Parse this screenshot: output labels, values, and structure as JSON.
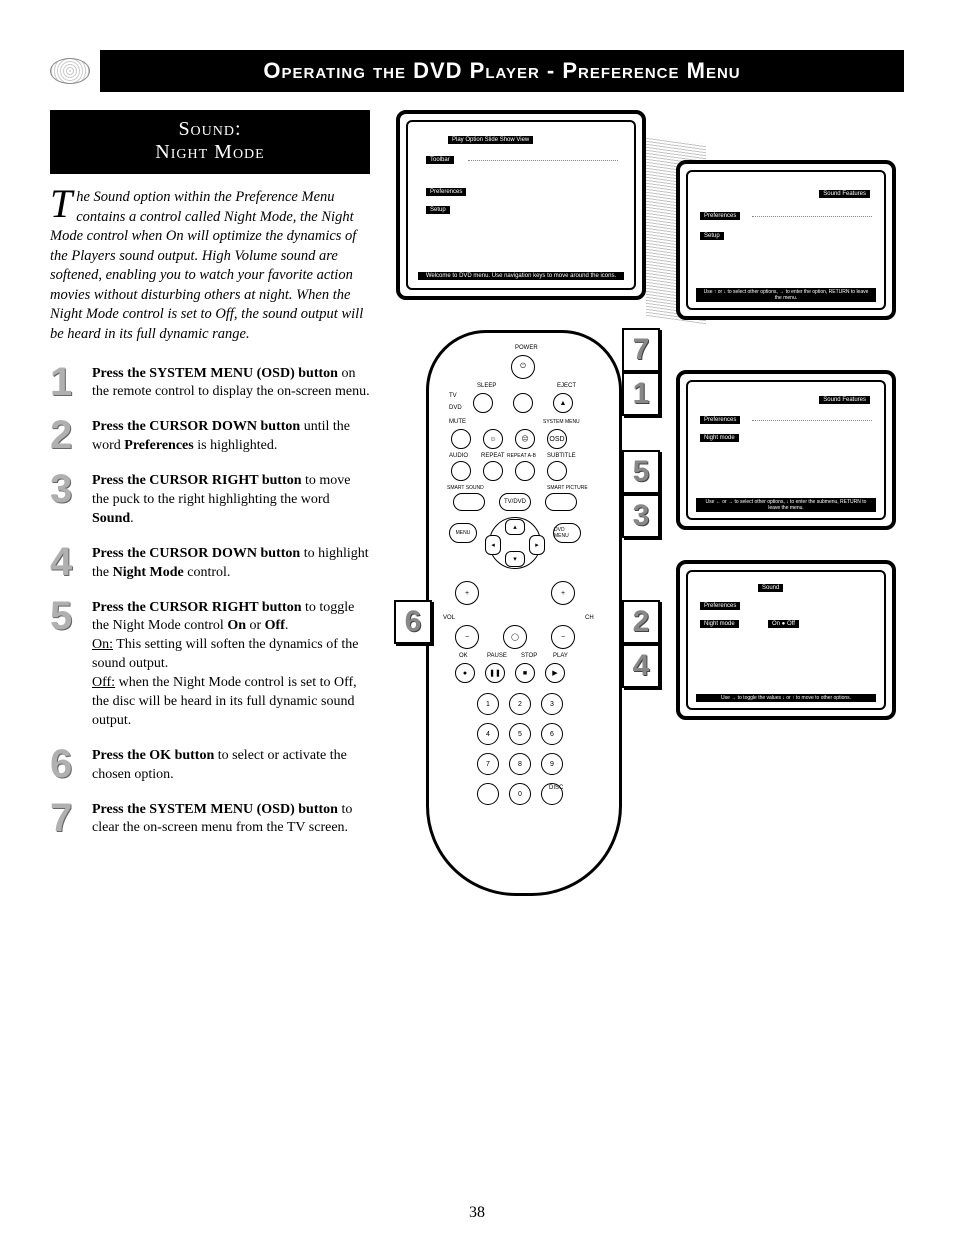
{
  "header": {
    "title": "Operating the DVD Player - Preference Menu"
  },
  "subheader": {
    "line1": "Sound:",
    "line2": "Night Mode"
  },
  "intro": {
    "dropcap": "T",
    "text": "he Sound option within the Preference Menu contains a control called Night Mode, the Night Mode control when On will optimize the dynamics of the Players sound output. High Volume sound are softened, enabling you to watch your favorite action movies without disturbing others at night. When the Night Mode control is set to Off, the sound output will be heard in its full dynamic range."
  },
  "steps": [
    {
      "num": "1",
      "bold": "Press the SYSTEM MENU (OSD) button",
      "rest": " on the remote control to display the on-screen menu."
    },
    {
      "num": "2",
      "bold": "Press the CURSOR DOWN button",
      "rest": " until the word <b>Preferences</b> is highlighted."
    },
    {
      "num": "3",
      "bold": "Press the CURSOR RIGHT button",
      "rest": " to move the puck to the right highlighting the word <b>Sound</b>."
    },
    {
      "num": "4",
      "bold": "Press the CURSOR DOWN button",
      "rest": " to highlight the <b>Night Mode</b> control."
    },
    {
      "num": "5",
      "bold": "Press the CURSOR RIGHT button",
      "rest": " to toggle the Night Mode control <b>On</b> or <b>Off</b>.<br><u>On:</u> This setting will soften the dynamics of the sound output.<br><u>Off:</u> when the Night Mode control is set to Off, the disc will be heard in its full dynamic sound output."
    },
    {
      "num": "6",
      "bold": "Press the OK button",
      "rest": " to select or activate the chosen option."
    },
    {
      "num": "7",
      "bold": "Press the SYSTEM MENU (OSD) button",
      "rest": " to clear the on-screen menu from the TV screen."
    }
  ],
  "tv_main": {
    "bar": "Play Option  Slide Show  View",
    "items": [
      "Toolbar",
      "Preferences",
      "Setup"
    ],
    "hint": "Welcome to DVD menu. Use navigation keys to move around the icons."
  },
  "tv1": {
    "cols": "Sound      Features",
    "items": [
      "Preferences",
      "Setup"
    ],
    "hint": "Use ↑ or ↓ to select other options, → to enter the option, RETURN to leave the menu."
  },
  "tv2": {
    "cols": "Sound      Features",
    "items": [
      "Preferences",
      "Night mode"
    ],
    "hint": "Use ← or → to select other options, ↓ to enter the submenu, RETURN to leave the menu."
  },
  "tv3": {
    "col": "Sound",
    "items": [
      "Preferences",
      "Night mode"
    ],
    "opts": "On    ●    Off",
    "hint": "Use → to toggle the values ↓ or ↑ to move to other options."
  },
  "remote_labels": {
    "power": "POWER",
    "sleep": "SLEEP",
    "eject": "EJECT",
    "tv": "TV",
    "dvd": "DVD",
    "mute": "MUTE",
    "system": "SYSTEM MENU",
    "audio": "AUDIO",
    "repeat": "REPEAT",
    "repeatab": "REPEAT A-B",
    "subtitle": "SUBTITLE",
    "smartsound": "SMART SOUND",
    "tvdvd": "TV/DVD",
    "smartpic": "SMART PICTURE",
    "menu": "MENU",
    "dvdmenu": "DVD MENU",
    "vol": "VOL",
    "ch": "CH",
    "ok": "OK",
    "pause": "PAUSE",
    "stop": "STOP",
    "play": "PLAY",
    "disc": "DISC"
  },
  "callouts": {
    "c1": "1",
    "c2": "2",
    "c3": "3",
    "c4": "4",
    "c5": "5",
    "c6": "6",
    "c7": "7"
  },
  "keypad": [
    "1",
    "2",
    "3",
    "4",
    "5",
    "6",
    "7",
    "8",
    "9",
    "0"
  ],
  "page_number": "38"
}
